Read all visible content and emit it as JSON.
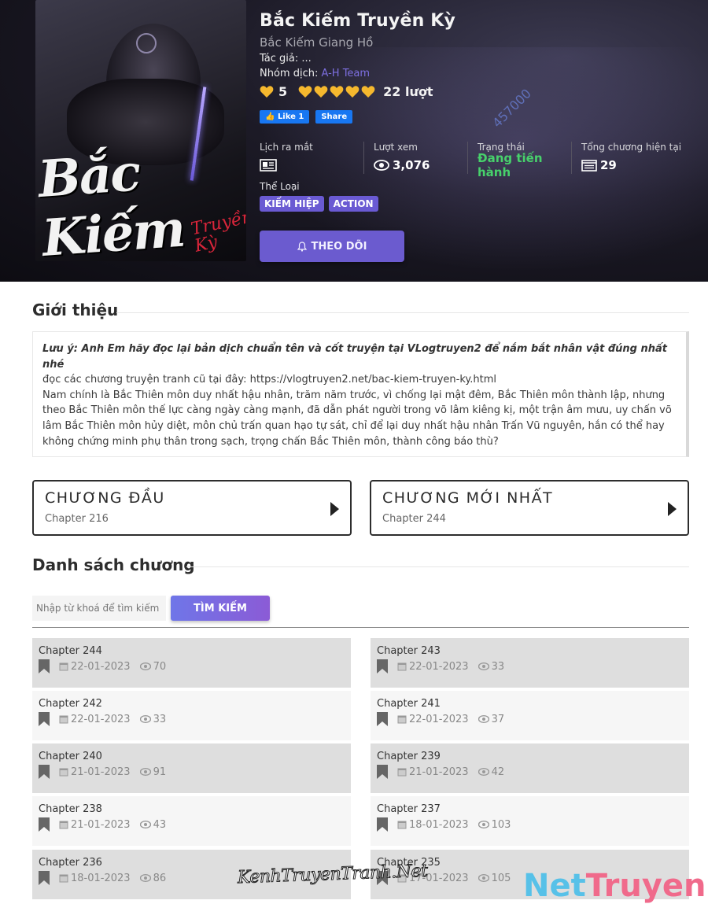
{
  "manga": {
    "title": "Bắc Kiếm Truyền Kỳ",
    "alt_title": "Bắc Kiếm Giang Hồ",
    "author_label": "Tác giả:",
    "author": "...",
    "group_label": "Nhóm dịch:",
    "group": "A-H Team",
    "rating_score": "5",
    "rating_votes": "22 lượt",
    "cover_title": "Bắc Kiếm",
    "cover_subtitle": "Truyền Kỳ",
    "watermark_number": "457000"
  },
  "facebook": {
    "like_label": "Like 1",
    "share_label": "Share"
  },
  "stats": {
    "release_label": "Lịch ra mắt",
    "views_label": "Lượt xem",
    "views_value": "3,076",
    "status_label": "Trạng thái",
    "status_value": "Đang tiến hành",
    "chapters_label": "Tổng chương hiện tại",
    "chapters_value": "29"
  },
  "genres": {
    "label": "Thể Loại",
    "items": [
      "KIẾM HIỆP",
      "ACTION"
    ]
  },
  "follow_button": "THEO DÕI",
  "intro": {
    "heading": "Giới thiệu",
    "note": "Lưu ý: Anh Em hãy đọc lại bản dịch chuẩn tên và cốt truyện tại VLogtruyen2 để nắm bắt nhân vật đúng nhất nhé",
    "link_line": "đọc các chương truyện tranh cũ tại đây: https://vlogtruyen2.net/bac-kiem-truyen-ky.html",
    "body": "Nam chính là Bắc Thiên môn duy nhất hậu nhân, trăm năm trước, vì chống lại mật đêm, Bắc Thiên môn thành lập, nhưng theo Bắc Thiên môn thế lực càng ngày càng mạnh, đã dẫn phát người trong võ lâm kiêng kị, một trận âm mưu, uy chấn võ lâm Bắc Thiên môn hủy diệt, môn chủ trấn quan hạo tự sát, chỉ để lại duy nhất hậu nhân Trấn Vũ nguyên, hắn có thể hay không chứng minh phụ thân trong sạch, trọng chấn Bắc Thiên môn, thành công báo thù?"
  },
  "chapter_nav": {
    "first_title": "CHƯƠNG ĐẦU",
    "first_sub": "Chapter 216",
    "latest_title": "CHƯƠNG MỚI NHẤT",
    "latest_sub": "Chapter 244"
  },
  "chapter_list": {
    "heading": "Danh sách chương",
    "search_placeholder": "Nhập từ khoá để tìm kiếm ...",
    "search_button": "TÌM KIẾM",
    "chapters": [
      {
        "name": "Chapter 244",
        "date": "22-01-2023",
        "views": "70"
      },
      {
        "name": "Chapter 243",
        "date": "22-01-2023",
        "views": "33"
      },
      {
        "name": "Chapter 242",
        "date": "22-01-2023",
        "views": "33"
      },
      {
        "name": "Chapter 241",
        "date": "22-01-2023",
        "views": "37"
      },
      {
        "name": "Chapter 240",
        "date": "21-01-2023",
        "views": "91"
      },
      {
        "name": "Chapter 239",
        "date": "21-01-2023",
        "views": "42"
      },
      {
        "name": "Chapter 238",
        "date": "21-01-2023",
        "views": "43"
      },
      {
        "name": "Chapter 237",
        "date": "18-01-2023",
        "views": "103"
      },
      {
        "name": "Chapter 236",
        "date": "18-01-2023",
        "views": "86"
      },
      {
        "name": "Chapter 235",
        "date": "17-01-2023",
        "views": "105"
      }
    ]
  },
  "watermarks": {
    "kenh": "KenhTruyenTranh.Net",
    "net_part1": "Net",
    "net_part2": "Truyen"
  },
  "colors": {
    "accent": "#6b5bcf",
    "status_green": "#47d16b",
    "heart": "#f5b82e",
    "link": "#7d6fe0"
  },
  "icons": [
    "newspaper-icon",
    "eye-icon",
    "list-icon",
    "bell-icon",
    "heart-icon",
    "bookmark-icon",
    "calendar-icon",
    "play-arrow-icon"
  ]
}
